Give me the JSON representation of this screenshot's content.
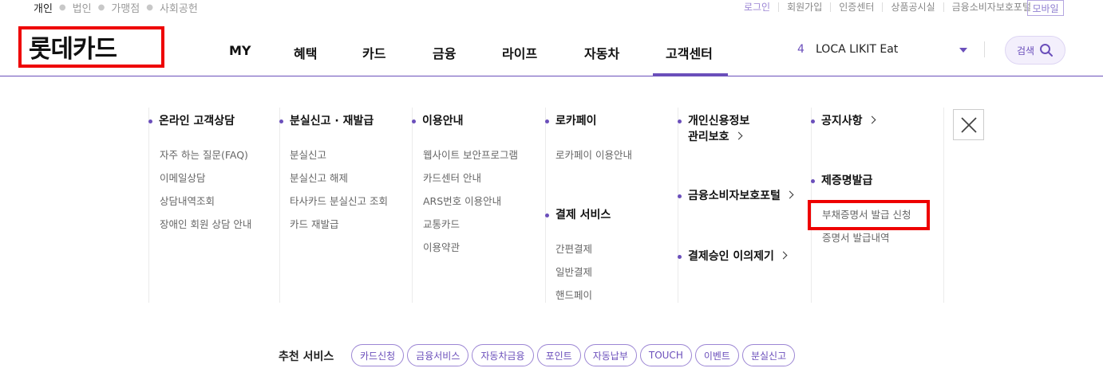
{
  "top_segment": [
    "개인",
    "법인",
    "가맹점",
    "사회공헌"
  ],
  "utility_links": [
    "로그인",
    "회원가입",
    "인증센터",
    "상품공시실",
    "금융소비자보호포털"
  ],
  "mobile_label": "모바일",
  "logo_text": "롯데카드",
  "gnb": [
    "MY",
    "혜택",
    "카드",
    "금융",
    "라이프",
    "자동차",
    "고객센터"
  ],
  "promo": {
    "number": "4",
    "text": "LOCA LIKIT Eat"
  },
  "search_label": "검색",
  "menu": {
    "online_title": "온라인 고객상담",
    "online_items": [
      "자주 하는 질문(FAQ)",
      "이메일상담",
      "상담내역조회",
      "장애인 회원 상담 안내"
    ],
    "lost_title": "분실신고 · 재발급",
    "lost_items": [
      "분실신고",
      "분실신고 해제",
      "타사카드 분실신고 조회",
      "카드 재발급"
    ],
    "guide_title": "이용안내",
    "guide_items": [
      "웹사이트 보안프로그램",
      "카드센터 안내",
      "ARS번호 이용안내",
      "교통카드",
      "이용약관"
    ],
    "locapay_title": "로카페이",
    "locapay_items": [
      "로카페이 이용안내"
    ],
    "payment_title": "결제 서비스",
    "payment_items": [
      "간편결제",
      "일반결제",
      "핸드페이"
    ],
    "credit_title_line1": "개인신용정보",
    "credit_title_line2": "관리보호",
    "consumer_portal": "금융소비자보호포털",
    "payment_dispute": "결제승인 이의제기",
    "notice": "공지사항",
    "cert_title": "제증명발급",
    "cert_items": [
      "부채증명서 발급 신청",
      "증명서 발급내역"
    ]
  },
  "recommend": {
    "label": "추천 서비스",
    "chips": [
      "카드신청",
      "금융서비스",
      "자동차금융",
      "포인트",
      "자동납부",
      "TOUCH",
      "이벤트",
      "분실신고"
    ]
  }
}
